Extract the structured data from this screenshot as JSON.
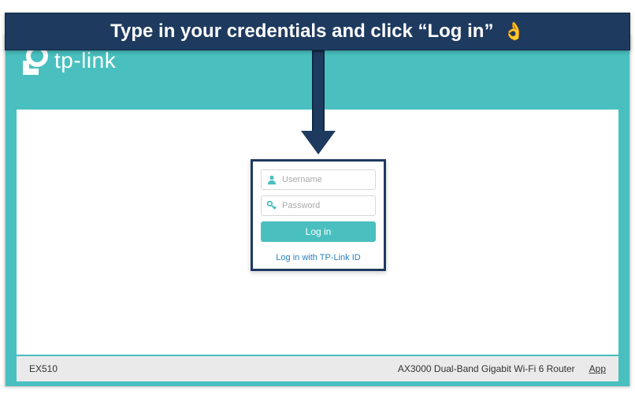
{
  "instruction": {
    "text": "Type in your credentials and click “Log in”",
    "emoji": "👌"
  },
  "brand": {
    "name": "tp-link"
  },
  "login": {
    "username_placeholder": "Username",
    "password_placeholder": "Password",
    "button_label": "Log in",
    "alt_login_label": "Log in with TP-Link ID"
  },
  "footer": {
    "model": "EX510",
    "product": "AX3000 Dual-Band Gigabit Wi-Fi 6 Router",
    "app_link": "App"
  },
  "colors": {
    "teal": "#49c0bf",
    "banner_navy": "#1e3a5f"
  }
}
